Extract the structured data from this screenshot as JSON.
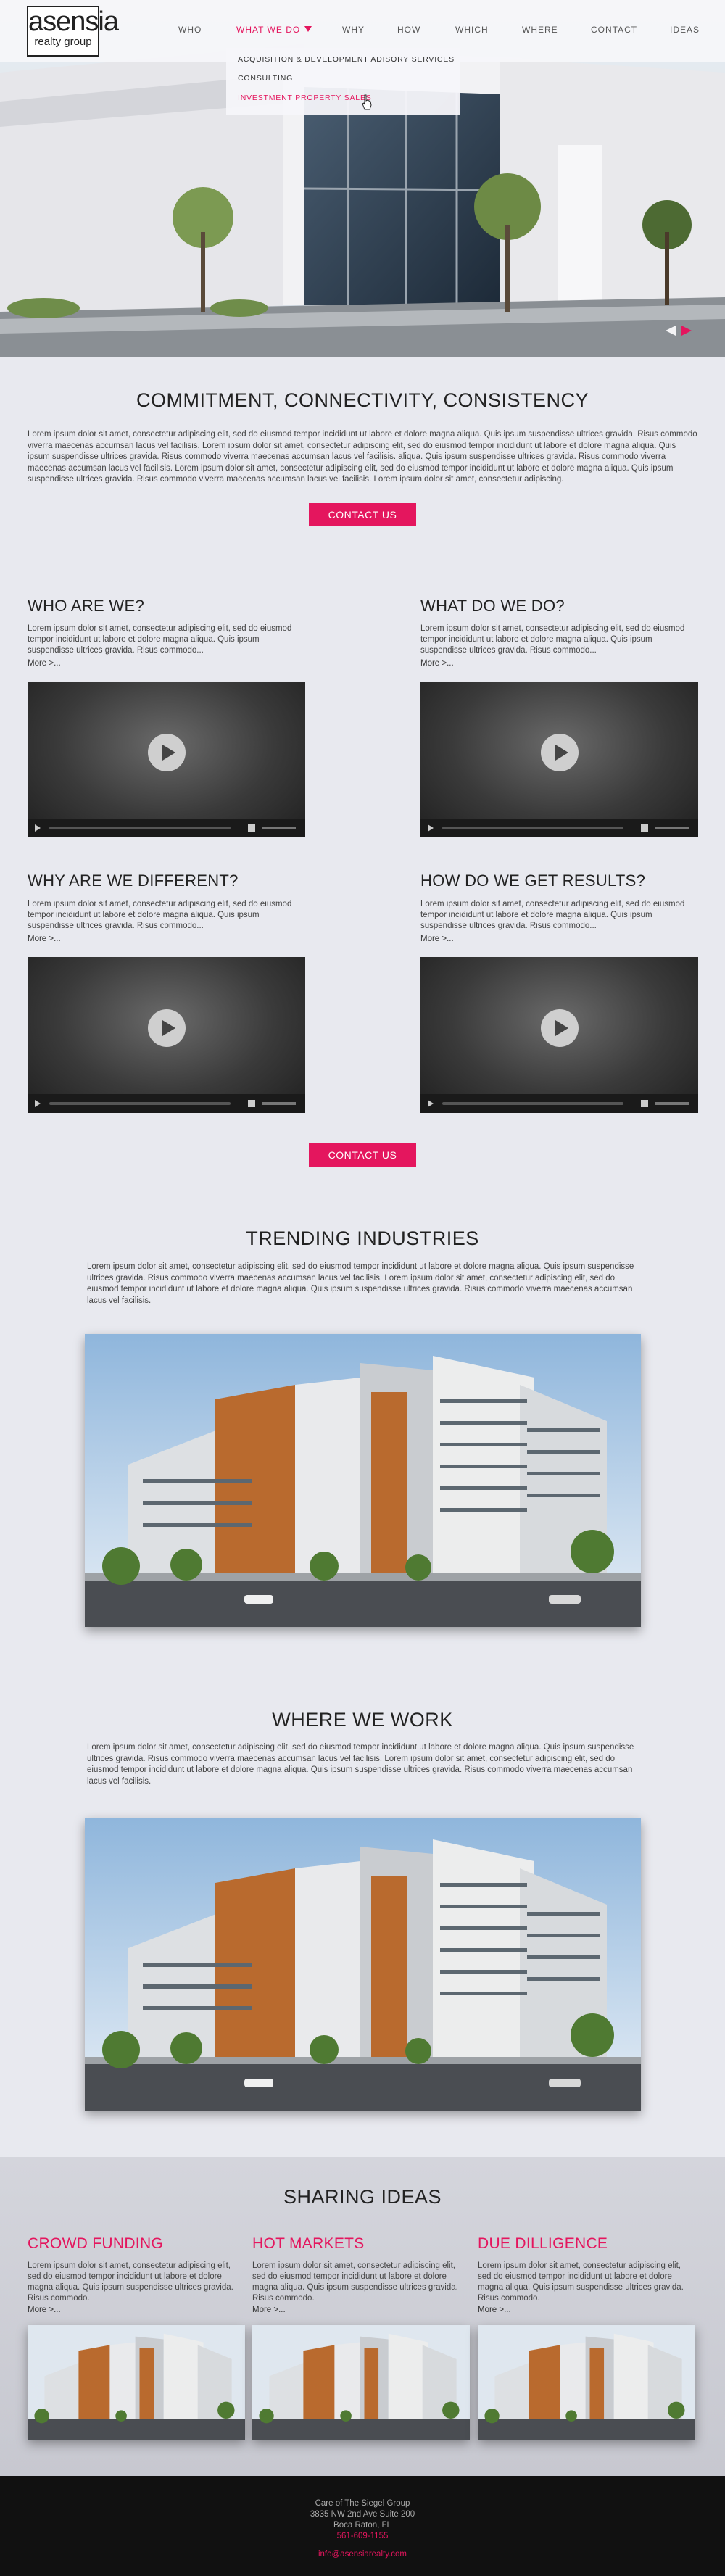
{
  "logo": {
    "line1": "asensia",
    "line2": "realty group"
  },
  "nav": {
    "items": [
      "WHO",
      "WHAT WE DO",
      "WHY",
      "HOW",
      "WHICH",
      "WHERE",
      "CONTACT",
      "IDEAS"
    ],
    "active_index": 1
  },
  "dropdown": {
    "items": [
      "ACQUISITION & DEVELOPMENT ADISORY SERVICES",
      "CONSULTING",
      "INVESTMENT PROPERTY SALES"
    ],
    "selected_index": 2
  },
  "intro": {
    "title": "COMMITMENT, CONNECTIVITY, CONSISTENCY",
    "paragraph": "Lorem ipsum dolor sit amet, consectetur adipiscing elit, sed do eiusmod tempor incididunt ut labore et dolore magna aliqua. Quis ipsum suspendisse ultrices gravida. Risus commodo viverra maecenas accumsan lacus vel facilisis. Lorem ipsum dolor sit amet, consectetur adipiscing elit, sed do eiusmod tempor incididunt ut labore et dolore magna aliqua. Quis ipsum suspendisse ultrices gravida. Risus commodo viverra maecenas accumsan lacus vel facilisis. aliqua. Quis ipsum suspendisse ultrices gravida. Risus commodo viverra maecenas accumsan lacus vel facilisis. Lorem ipsum dolor sit amet, consectetur adipiscing elit, sed do eiusmod tempor incididunt ut labore et dolore magna aliqua. Quis ipsum suspendisse ultrices gravida. Risus commodo viverra maecenas accumsan lacus vel facilisis. Lorem ipsum dolor sit amet, consectetur adipiscing.",
    "button": "CONTACT US"
  },
  "videos": [
    {
      "title": "WHO ARE WE?",
      "text": "Lorem ipsum dolor sit amet, consectetur adipiscing elit, sed do eiusmod tempor incididunt ut labore et dolore magna aliqua. Quis ipsum suspendisse ultrices gravida. Risus commodo...",
      "more": "More >..."
    },
    {
      "title": "WHAT DO WE DO?",
      "text": "Lorem ipsum dolor sit amet, consectetur adipiscing elit, sed do eiusmod tempor incididunt ut labore et dolore magna aliqua. Quis ipsum suspendisse ultrices gravida. Risus commodo...",
      "more": "More >..."
    },
    {
      "title": "WHY ARE WE DIFFERENT?",
      "text": "Lorem ipsum dolor sit amet, consectetur adipiscing elit, sed do eiusmod tempor incididunt ut labore et dolore magna aliqua. Quis ipsum suspendisse ultrices gravida. Risus commodo...",
      "more": "More >..."
    },
    {
      "title": "HOW DO WE GET RESULTS?",
      "text": "Lorem ipsum dolor sit amet, consectetur adipiscing elit, sed do eiusmod tempor incididunt ut labore et dolore magna aliqua. Quis ipsum suspendisse ultrices gravida. Risus commodo...",
      "more": "More >..."
    }
  ],
  "contact_button_2": "CONTACT US",
  "trending": {
    "title": "TRENDING INDUSTRIES",
    "paragraph": "Lorem ipsum dolor sit amet, consectetur adipiscing elit, sed do eiusmod tempor incididunt ut labore et dolore magna aliqua. Quis ipsum suspendisse ultrices gravida. Risus commodo viverra maecenas accumsan lacus vel facilisis. Lorem ipsum dolor sit amet, consectetur adipiscing elit, sed do eiusmod tempor incididunt ut labore et dolore magna aliqua. Quis ipsum suspendisse ultrices gravida. Risus commodo viverra maecenas accumsan lacus vel facilisis."
  },
  "where": {
    "title": "WHERE WE WORK",
    "paragraph": "Lorem ipsum dolor sit amet, consectetur adipiscing elit, sed do eiusmod tempor incididunt ut labore et dolore magna aliqua. Quis ipsum suspendisse ultrices gravida. Risus commodo viverra maecenas accumsan lacus vel facilisis. Lorem ipsum dolor sit amet, consectetur adipiscing elit, sed do eiusmod tempor incididunt ut labore et dolore magna aliqua. Quis ipsum suspendisse ultrices gravida. Risus commodo viverra maecenas accumsan lacus vel facilisis."
  },
  "sharing": {
    "title": "SHARING IDEAS",
    "columns": [
      {
        "title": "CROWD FUNDING",
        "text": "Lorem ipsum dolor sit amet, consectetur adipiscing elit, sed do eiusmod tempor incididunt ut labore et dolore magna aliqua. Quis ipsum suspendisse ultrices gravida. Risus commodo.",
        "more": "More >..."
      },
      {
        "title": "HOT MARKETS",
        "text": "Lorem ipsum dolor sit amet, consectetur adipiscing elit, sed do eiusmod tempor incididunt ut labore et dolore magna aliqua. Quis ipsum suspendisse ultrices gravida. Risus commodo.",
        "more": "More >..."
      },
      {
        "title": "DUE DILLIGENCE",
        "text": "Lorem ipsum dolor sit amet, consectetur adipiscing elit, sed do eiusmod tempor incididunt ut labore et dolore magna aliqua. Quis ipsum suspendisse ultrices gravida. Risus commodo.",
        "more": "More >..."
      }
    ]
  },
  "footer": {
    "line1": "Care of The Siegel Group",
    "line2": "3835 NW 2nd Ave Suite 200",
    "line3": "Boca Raton, FL",
    "phone": "561-609-1155",
    "email": "info@asensiarealty.com"
  },
  "colors": {
    "accent": "#e4165e",
    "background": "#e8e9ef",
    "footer": "#111111"
  }
}
